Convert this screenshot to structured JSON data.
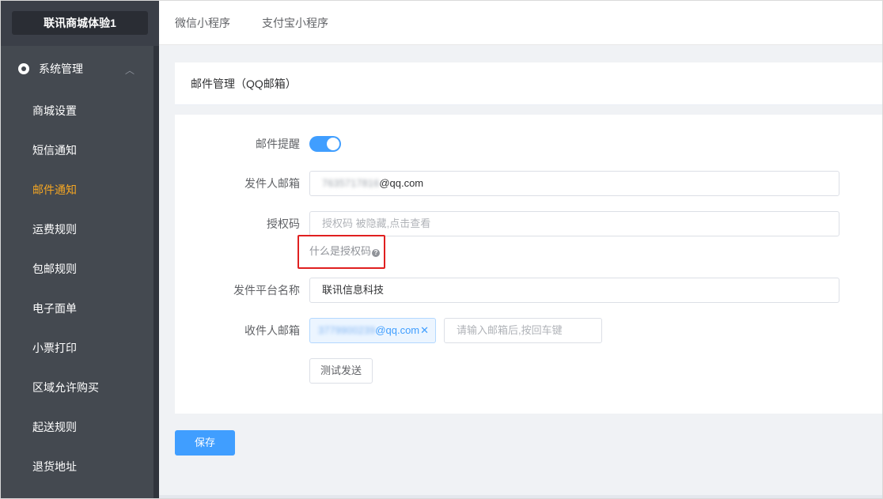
{
  "sidebar": {
    "brand": "联讯商城体验1",
    "group_label": "系统管理",
    "group_icon": "gear-icon",
    "items": [
      {
        "label": "商城设置",
        "active": false
      },
      {
        "label": "短信通知",
        "active": false
      },
      {
        "label": "邮件通知",
        "active": true
      },
      {
        "label": "运费规则",
        "active": false
      },
      {
        "label": "包邮规则",
        "active": false
      },
      {
        "label": "电子面单",
        "active": false
      },
      {
        "label": "小票打印",
        "active": false
      },
      {
        "label": "区域允许购买",
        "active": false
      },
      {
        "label": "起送规则",
        "active": false
      },
      {
        "label": "退货地址",
        "active": false
      }
    ]
  },
  "topbar": {
    "tabs": [
      "微信小程序",
      "支付宝小程序"
    ]
  },
  "panel": {
    "title": "邮件管理（QQ邮箱）"
  },
  "form": {
    "reminder_label": "邮件提醒",
    "reminder_enabled": true,
    "sender_label": "发件人邮箱",
    "sender_value_hidden": "7635717816",
    "sender_value_domain": "@qq.com",
    "auth_label": "授权码",
    "auth_placeholder": "授权码 被隐藏,点击查看",
    "auth_help": "什么是授权码",
    "platform_label": "发件平台名称",
    "platform_value": "联讯信息科技",
    "recipient_label": "收件人邮箱",
    "recipient_tag_hidden": "3779900239",
    "recipient_tag_domain": "@qq.com",
    "recipient_placeholder": "请输入邮箱后,按回车键",
    "test_button": "测试发送"
  },
  "footer": {
    "save_button": "保存"
  },
  "colors": {
    "accent": "#409eff",
    "active_menu": "#f5a623",
    "sidebar_bg": "#444950",
    "highlight": "#e02020"
  }
}
